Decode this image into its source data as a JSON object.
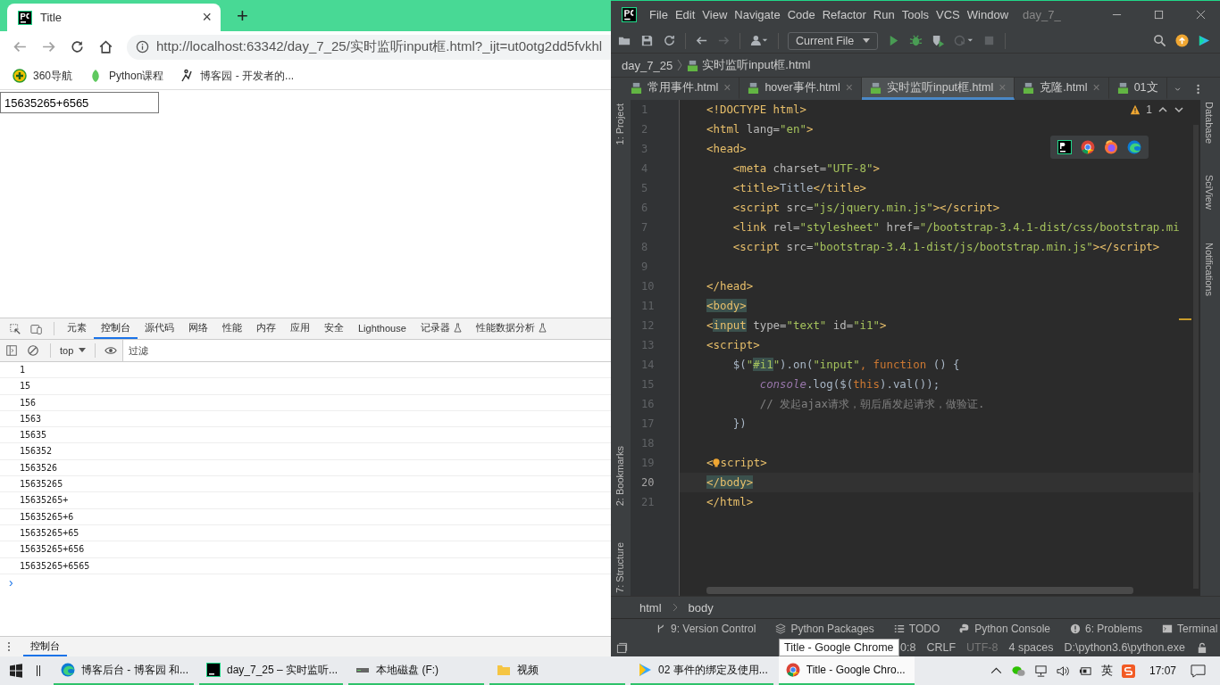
{
  "browser": {
    "tab": {
      "title": "Title",
      "close": "×"
    },
    "new_tab": "+",
    "url": "http://localhost:63342/day_7_25/实时监听input框.html?_ijt=ut0otg2dd5fvkhl",
    "bookmarks": [
      {
        "label": "360导航",
        "kind": "plus"
      },
      {
        "label": "Python课程",
        "kind": "leaf"
      },
      {
        "label": "博客园 - 开发者的...",
        "kind": "runner"
      }
    ],
    "page_input": {
      "value": "15635265+6565"
    },
    "devtools": {
      "tabs": [
        {
          "label": "元素",
          "selected": false
        },
        {
          "label": "控制台",
          "selected": true
        },
        {
          "label": "源代码",
          "selected": false
        },
        {
          "label": "网络",
          "selected": false
        },
        {
          "label": "性能",
          "selected": false
        },
        {
          "label": "内存",
          "selected": false
        },
        {
          "label": "应用",
          "selected": false
        },
        {
          "label": "安全",
          "selected": false
        },
        {
          "label": "Lighthouse",
          "selected": false
        },
        {
          "label": "记录器",
          "selected": false,
          "flask": true
        },
        {
          "label": "性能数据分析",
          "selected": false,
          "flask": true
        }
      ],
      "context": "top",
      "filter": {
        "placeholder": "过滤"
      },
      "logs": [
        "1",
        "15",
        "156",
        "1563",
        "15635",
        "156352",
        "1563526",
        "15635265",
        "15635265+",
        "15635265+6",
        "15635265+65",
        "15635265+656",
        "15635265+6565"
      ],
      "prompt": "›",
      "drawer_tab": {
        "label": "控制台",
        "selected": true
      }
    }
  },
  "ide": {
    "menu": [
      "File",
      "Edit",
      "View",
      "Navigate",
      "Code",
      "Refactor",
      "Run",
      "Tools",
      "VCS",
      "Window"
    ],
    "project_title": "day_7_",
    "run_config": "Current File",
    "breadcrumb": [
      "day_7_25",
      "实时监听input框.html"
    ],
    "tabs": [
      {
        "label": "常用事件.html",
        "selected": false,
        "close": "×"
      },
      {
        "label": "hover事件.html",
        "selected": false,
        "close": "×"
      },
      {
        "label": "实时监听input框.html",
        "selected": true,
        "close": "×"
      },
      {
        "label": "克隆.html",
        "selected": false,
        "close": "×"
      },
      {
        "label": "01文",
        "selected": false
      }
    ],
    "left_tools": [
      "1: Project",
      "2: Bookmarks",
      "7: Structure"
    ],
    "right_tools": [
      "Database",
      "SciView",
      "Notifications"
    ],
    "warnings": "1",
    "lines": [
      {
        "n": "1",
        "current": false,
        "tokens": [
          {
            "t": "<!DOCTYPE html>",
            "kind": "tag"
          }
        ]
      },
      {
        "n": "2",
        "current": false,
        "tokens": [
          {
            "t": "<html",
            "kind": "tag"
          },
          {
            "t": " lang=",
            "kind": "attr"
          },
          {
            "t": "\"en\"",
            "kind": "str"
          },
          {
            "t": ">",
            "kind": "tag"
          }
        ]
      },
      {
        "n": "3",
        "current": false,
        "tokens": [
          {
            "t": "<head>",
            "kind": "tag"
          }
        ]
      },
      {
        "n": "4",
        "current": false,
        "tokens": [
          {
            "t": "    <meta",
            "kind": "tag"
          },
          {
            "t": " charset=",
            "kind": "attr"
          },
          {
            "t": "\"UTF-8\"",
            "kind": "str"
          },
          {
            "t": ">",
            "kind": "tag"
          }
        ]
      },
      {
        "n": "5",
        "current": false,
        "tokens": [
          {
            "t": "    <title>",
            "kind": "tag"
          },
          {
            "t": "Title",
            "kind": "plain"
          },
          {
            "t": "</title>",
            "kind": "tag"
          }
        ]
      },
      {
        "n": "6",
        "current": false,
        "tokens": [
          {
            "t": "    <script",
            "kind": "tag"
          },
          {
            "t": " src=",
            "kind": "attr"
          },
          {
            "t": "\"js/jquery.min.js\"",
            "kind": "str"
          },
          {
            "t": "></script>",
            "kind": "tag"
          }
        ]
      },
      {
        "n": "7",
        "current": false,
        "tokens": [
          {
            "t": "    <link",
            "kind": "tag"
          },
          {
            "t": " rel=",
            "kind": "attr"
          },
          {
            "t": "\"stylesheet\"",
            "kind": "str"
          },
          {
            "t": " href=",
            "kind": "attr"
          },
          {
            "t": "\"/bootstrap-3.4.1-dist/css/bootstrap.mi",
            "kind": "str"
          }
        ]
      },
      {
        "n": "8",
        "current": false,
        "tokens": [
          {
            "t": "    <script",
            "kind": "tag"
          },
          {
            "t": " src=",
            "kind": "attr"
          },
          {
            "t": "\"bootstrap-3.4.1-dist/js/bootstrap.min.js\"",
            "kind": "str"
          },
          {
            "t": "></script>",
            "kind": "tag"
          }
        ]
      },
      {
        "n": "9",
        "current": false
      },
      {
        "n": "10",
        "current": false,
        "tokens": [
          {
            "t": "</head>",
            "kind": "tag"
          }
        ]
      },
      {
        "n": "11",
        "current": false,
        "tokens": [
          {
            "t": "<body>",
            "kind": "taghl"
          }
        ]
      },
      {
        "n": "12",
        "current": false,
        "tokens": [
          {
            "t": "<",
            "kind": "tag"
          },
          {
            "t": "input",
            "kind": "taghl"
          },
          {
            "t": " type=",
            "kind": "attr"
          },
          {
            "t": "\"text\"",
            "kind": "str"
          },
          {
            "t": " id=",
            "kind": "attr"
          },
          {
            "t": "\"i1\"",
            "kind": "str"
          },
          {
            "t": ">",
            "kind": "tag"
          }
        ]
      },
      {
        "n": "13",
        "current": false,
        "tokens": [
          {
            "t": "<script>",
            "kind": "tag"
          }
        ]
      },
      {
        "n": "14",
        "current": false,
        "tokens": [
          {
            "t": "    $(",
            "kind": "plain"
          },
          {
            "t": "\"",
            "kind": "str"
          },
          {
            "t": "#i1",
            "kind": "strhl"
          },
          {
            "t": "\"",
            "kind": "str"
          },
          {
            "t": ").on(",
            "kind": "plain"
          },
          {
            "t": "\"input\"",
            "kind": "str"
          },
          {
            "t": ", function",
            "kind": "kw"
          },
          {
            "t": " () {",
            "kind": "plain"
          }
        ]
      },
      {
        "n": "15",
        "current": false,
        "tokens": [
          {
            "t": "        console",
            "kind": "ital"
          },
          {
            "t": ".log($(",
            "kind": "plain"
          },
          {
            "t": "this",
            "kind": "kw"
          },
          {
            "t": ").val());",
            "kind": "plain"
          }
        ]
      },
      {
        "n": "16",
        "current": false,
        "tokens": [
          {
            "t": "        // 发起ajax请求，朝后盾发起请求，做验证.",
            "kind": "comment"
          }
        ]
      },
      {
        "n": "17",
        "current": false,
        "tokens": [
          {
            "t": "    })",
            "kind": "plain"
          }
        ]
      },
      {
        "n": "18",
        "current": false
      },
      {
        "n": "19",
        "current": false,
        "tokens": [
          {
            "t": "<",
            "kind": "tag"
          },
          {
            "kind": "bulb"
          },
          {
            "t": "script>",
            "kind": "tag"
          }
        ]
      },
      {
        "n": "20",
        "current": true,
        "tokens": [
          {
            "t": "</body>",
            "kind": "taghl"
          }
        ]
      },
      {
        "n": "21",
        "current": false,
        "tokens": [
          {
            "t": "</html>",
            "kind": "tag"
          }
        ]
      }
    ],
    "path": [
      "html",
      "body"
    ],
    "tool_windows": [
      {
        "label": "9: Version Control",
        "kind": "branch"
      },
      {
        "label": "Python Packages",
        "kind": "layers"
      },
      {
        "label": "TODO",
        "kind": "list"
      },
      {
        "label": "Python Console",
        "kind": "python"
      },
      {
        "label": "6: Problems",
        "kind": "alert"
      },
      {
        "label": "Terminal",
        "kind": "terminal"
      }
    ],
    "status": [
      {
        "label": "0:8",
        "dim": false
      },
      {
        "label": "CRLF",
        "dim": false
      },
      {
        "label": "UTF-8",
        "dim": true
      },
      {
        "label": "4 spaces",
        "dim": false
      },
      {
        "label": "D:\\python3.6\\python.exe",
        "dim": false
      }
    ],
    "tooltip": "Title - Google Chrome"
  },
  "taskbar": {
    "items": [
      {
        "label": "博客后台 - 博客园 和...",
        "kind": "edge",
        "selected": false
      },
      {
        "label": "day_7_25 – 实时监听...",
        "kind": "pycharm",
        "selected": false
      },
      {
        "label": "本地磁盘 (F:)",
        "kind": "drive",
        "selected": false
      },
      {
        "label": "视频",
        "kind": "folder",
        "selected": false
      },
      {
        "label": "02 事件的绑定及使用...",
        "kind": "player",
        "selected": false
      },
      {
        "label": "Title - Google Chro...",
        "kind": "chrome",
        "selected": true
      }
    ],
    "ime": "英",
    "time": "17:07"
  }
}
